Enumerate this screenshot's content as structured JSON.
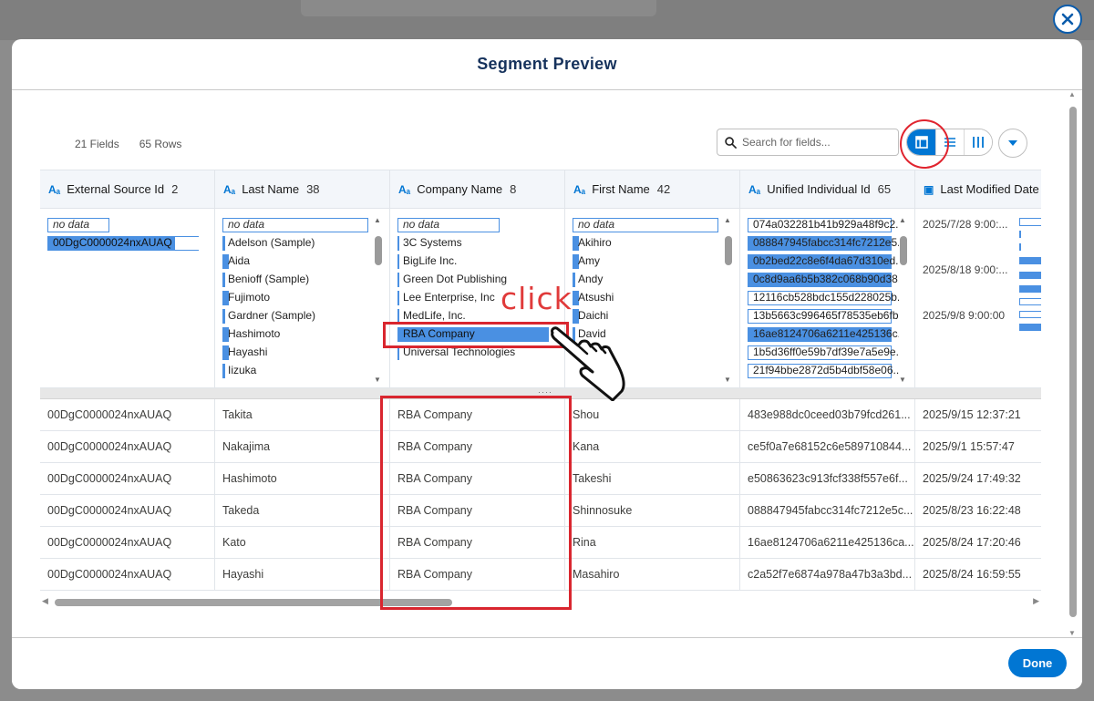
{
  "modal": {
    "title": "Segment Preview",
    "done_label": "Done"
  },
  "toolbar": {
    "fields_count": "21 Fields",
    "rows_count": "65 Rows",
    "search_placeholder": "Search for fields..."
  },
  "columns": [
    {
      "label": "External Source Id",
      "count": "2"
    },
    {
      "label": "Last Name",
      "count": "38"
    },
    {
      "label": "Company Name",
      "count": "8"
    },
    {
      "label": "First Name",
      "count": "42"
    },
    {
      "label": "Unified Individual Id",
      "count": "65"
    },
    {
      "label": "Last Modified Date",
      "count": ""
    }
  ],
  "facets": {
    "no_data_label": "no data",
    "external_source_id": [
      "00DgC0000024nxAUAQ"
    ],
    "last_name": [
      "Adelson (Sample)",
      "Aida",
      "Benioff (Sample)",
      "Fujimoto",
      "Gardner (Sample)",
      "Hashimoto",
      "Hayashi",
      "Iizuka"
    ],
    "company_name": [
      "3C Systems",
      "BigLife Inc.",
      "Green Dot Publishing",
      "Lee Enterprise, Inc",
      "MedLife, Inc.",
      "RBA Company",
      "Universal Technologies"
    ],
    "first_name": [
      "Akihiro",
      "Amy",
      "Andy",
      "Atsushi",
      "Daichi",
      "David"
    ],
    "unified_individual_id": [
      "074a032281b41b929a48f9c2...",
      "088847945fabcc314fc7212e5...",
      "0b2bed22c8e6f4da67d310ed...",
      "0c8d9aa6b5b382c068b90d38...",
      "12116cb528bdc155d228025b...",
      "13b5663c996465f78535eb6fb...",
      "16ae8124706a6211e425136c...",
      "1b5d36ff0e59b7df39e7a5e9e...",
      "21f94bbe2872d5b4dbf58e06..."
    ],
    "last_modified_date": [
      "2025/7/28 9:00:...",
      "2025/8/18 9:00:...",
      "2025/9/8 9:00:00"
    ]
  },
  "rows": [
    [
      "00DgC0000024nxAUAQ",
      "Takita",
      "RBA Company",
      "Shou",
      "483e988dc0ceed03b79fcd261...",
      "2025/9/15 12:37:21"
    ],
    [
      "00DgC0000024nxAUAQ",
      "Nakajima",
      "RBA Company",
      "Kana",
      "ce5f0a7e68152c6e589710844...",
      "2025/9/1 15:57:47"
    ],
    [
      "00DgC0000024nxAUAQ",
      "Hashimoto",
      "RBA Company",
      "Takeshi",
      "e50863623c913fcf338f557e6f...",
      "2025/9/24 17:49:32"
    ],
    [
      "00DgC0000024nxAUAQ",
      "Takeda",
      "RBA Company",
      "Shinnosuke",
      "088847945fabcc314fc7212e5c...",
      "2025/8/23 16:22:48"
    ],
    [
      "00DgC0000024nxAUAQ",
      "Kato",
      "RBA Company",
      "Rina",
      "16ae8124706a6211e425136ca...",
      "2025/8/24 17:20:46"
    ],
    [
      "00DgC0000024nxAUAQ",
      "Hayashi",
      "RBA Company",
      "Masahiro",
      "c2a52f7e6874a978a47b3a3bd...",
      "2025/8/24 16:59:55"
    ]
  ],
  "annotation": {
    "click_text": "click"
  },
  "colors": {
    "accent": "#0176d3",
    "highlight": "#d9262f",
    "bar": "#4a90e2"
  }
}
